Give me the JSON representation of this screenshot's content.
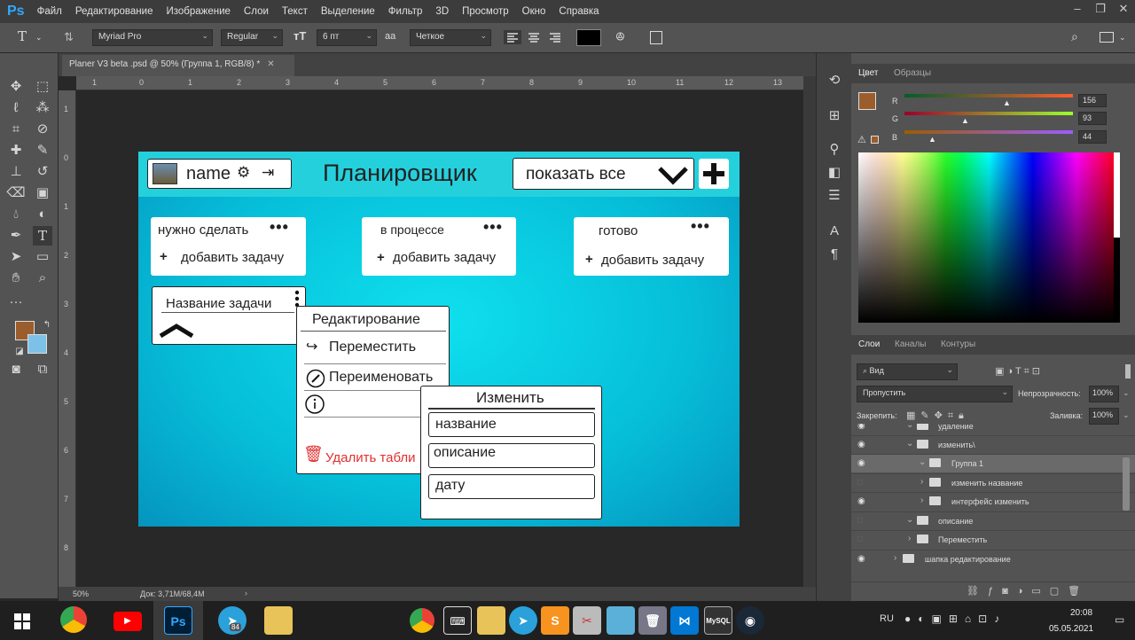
{
  "app": {
    "logo": "Ps"
  },
  "menu": [
    "Файл",
    "Редактирование",
    "Изображение",
    "Слои",
    "Текст",
    "Выделение",
    "Фильтр",
    "3D",
    "Просмотр",
    "Окно",
    "Справка"
  ],
  "options": {
    "font_family": "Myriad Pro",
    "font_style": "Regular",
    "font_size": "6 пт",
    "antialias": "Четкое",
    "text_color": "#000000"
  },
  "document": {
    "tab_title": "Planer V3 beta .psd @ 50% (Группа 1, RGB/8) *",
    "zoom": "50%",
    "doc_size": "Док: 3,71M/68,4M"
  },
  "rulers": {
    "h": [
      "1",
      "0",
      "1",
      "2",
      "3",
      "4",
      "5",
      "6",
      "7",
      "8",
      "9",
      "10",
      "11",
      "12",
      "13"
    ],
    "v": [
      "1",
      "0",
      "1",
      "2",
      "3",
      "4",
      "5",
      "6",
      "7",
      "8"
    ]
  },
  "design": {
    "username": "name",
    "title": "Планировщик",
    "filter": "показать все",
    "columns": [
      {
        "title": "нужно сделать",
        "add": "добавить задачу"
      },
      {
        "title": "в процессе",
        "add": "добавить задачу"
      },
      {
        "title": "готово",
        "add": "добавить задачу"
      }
    ],
    "task_name": "Название задачи",
    "edit_menu": {
      "title": "Редактирование",
      "move": "Переместить",
      "rename": "Переименовать",
      "delete": "Удалить табли"
    },
    "change_menu": {
      "title": "Изменить",
      "fields": [
        "название",
        "описание",
        "дату"
      ]
    },
    "colors": {
      "cyan": "#25d0dd",
      "delete": "#e03030"
    }
  },
  "color_panel": {
    "tabs": [
      "Цвет",
      "Образцы"
    ],
    "channels": [
      {
        "label": "R",
        "value": "156"
      },
      {
        "label": "G",
        "value": "93"
      },
      {
        "label": "B",
        "value": "44"
      }
    ],
    "foreground": "#9c5d2c",
    "background": "#7ec1e8"
  },
  "layers_panel": {
    "tabs": [
      "Слои",
      "Каналы",
      "Контуры"
    ],
    "kind": "Вид",
    "blend": "Пропустить",
    "opacity_label": "Непрозрачность:",
    "opacity": "100%",
    "lock_label": "Закрепить:",
    "fill_label": "Заливка:",
    "fill": "100%",
    "layers": [
      {
        "name": "удаление",
        "visible": true,
        "indent": 1
      },
      {
        "name": "изменить\\",
        "visible": true,
        "indent": 1
      },
      {
        "name": "Группа 1",
        "visible": true,
        "indent": 2,
        "selected": true
      },
      {
        "name": "изменить название",
        "visible": false,
        "indent": 3
      },
      {
        "name": "интерфейс изменить",
        "visible": true,
        "indent": 3
      },
      {
        "name": "описание",
        "visible": false,
        "indent": 1
      },
      {
        "name": "Переместить",
        "visible": false,
        "indent": 1
      },
      {
        "name": "шапка редактирование",
        "visible": true,
        "indent": 0
      }
    ]
  },
  "taskbar": {
    "lang": "RU",
    "time": "20:08",
    "date": "05.05.2021",
    "telegram_badge": "84"
  }
}
